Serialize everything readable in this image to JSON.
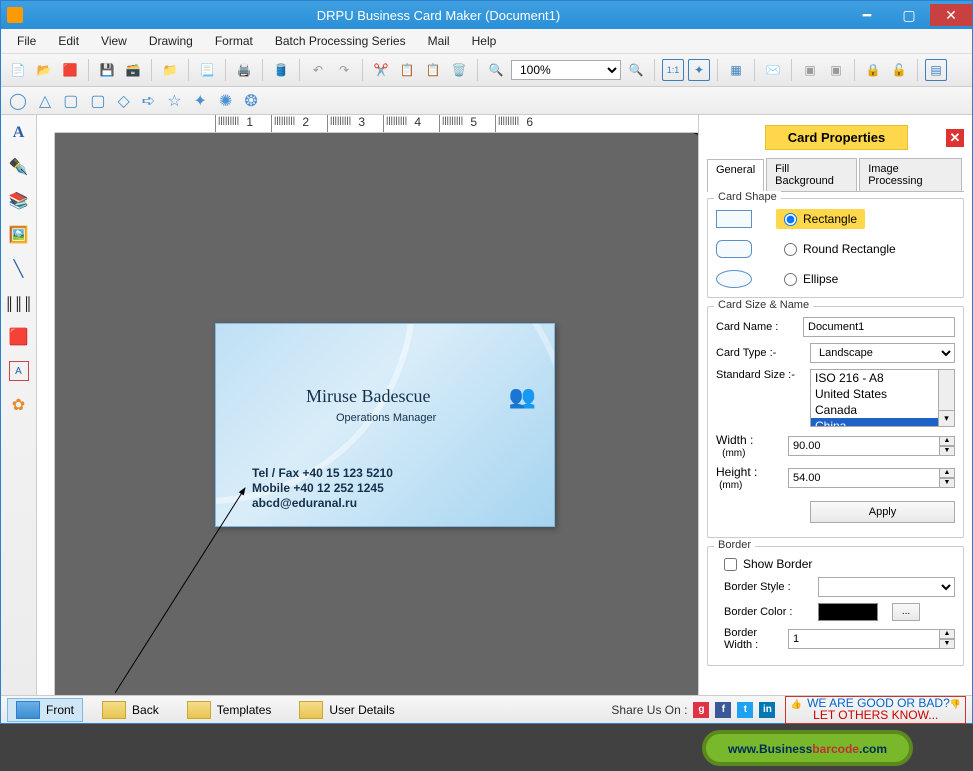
{
  "title": "DRPU Business Card Maker (Document1)",
  "menu": [
    "File",
    "Edit",
    "View",
    "Drawing",
    "Format",
    "Batch Processing Series",
    "Mail",
    "Help"
  ],
  "zoom": "100%",
  "ruler_marks": [
    "1",
    "2",
    "3",
    "4",
    "5",
    "6"
  ],
  "card": {
    "name": "Miruse Badescue",
    "role": "Operations Manager",
    "line1": "Tel / Fax +40 15 123 5210",
    "line2": "Mobile   +40 12 252 1245",
    "line3": "abcd@eduranal.ru"
  },
  "panel": {
    "title": "Card Properties",
    "tabs": [
      "General",
      "Fill Background",
      "Image Processing"
    ],
    "shape_group": "Card Shape",
    "shapes": {
      "rect": "Rectangle",
      "round": "Round Rectangle",
      "ellipse": "Ellipse"
    },
    "size_group": "Card Size & Name",
    "card_name_lbl": "Card Name :",
    "card_name_val": "Document1",
    "card_type_lbl": "Card Type :-",
    "card_type_val": "Landscape",
    "std_size_lbl": "Standard Size :-",
    "std_options": [
      "ISO 216 - A8",
      "United States",
      "Canada",
      "China"
    ],
    "width_lbl": "Width :",
    "mm": "(mm)",
    "width_val": "90.00",
    "height_lbl": "Height :",
    "height_val": "54.00",
    "apply": "Apply",
    "border_group": "Border",
    "show_border": "Show Border",
    "border_style_lbl": "Border Style :",
    "border_color_lbl": "Border Color :",
    "border_width_lbl": "Border Width :",
    "border_width_val": "1",
    "dots": "..."
  },
  "status": {
    "front": "Front",
    "back": "Back",
    "templates": "Templates",
    "user": "User Details",
    "share": "Share Us On :",
    "goodbad1": "WE ARE GOOD OR BAD?",
    "goodbad2": "LET OTHERS KNOW..."
  },
  "footer_url": "www.Businessbarcode.com"
}
